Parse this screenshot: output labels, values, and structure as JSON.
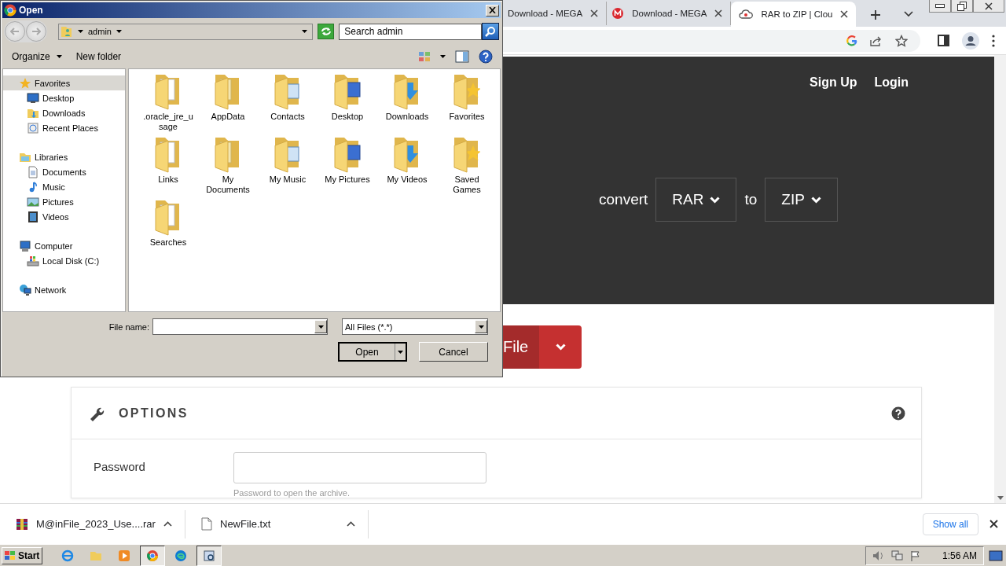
{
  "browser": {
    "tabs": [
      {
        "label": "Download - MEGA",
        "selected": false
      },
      {
        "label": "Download - MEGA",
        "selected": false
      },
      {
        "label": "RAR to ZIP | Clou",
        "selected": true
      }
    ],
    "nav_links": [
      "Sign Up",
      "Login"
    ],
    "converter": {
      "prefix": "convert",
      "from": "RAR",
      "joiner": "to",
      "to": "ZIP"
    },
    "upload_button": "File",
    "options": {
      "title": "OPTIONS",
      "fields": [
        {
          "label": "Password",
          "hint": "Password to open the archive."
        }
      ]
    }
  },
  "dialog": {
    "title": "Open",
    "address_path": "admin",
    "search_placeholder": "Search admin",
    "toolbar": [
      "Organize",
      "New folder"
    ],
    "nav": [
      {
        "label": "Favorites",
        "selected": true,
        "children": [
          {
            "label": "Desktop",
            "selected": false
          },
          {
            "label": "Downloads",
            "selected": false
          },
          {
            "label": "Recent Places",
            "selected": false
          }
        ]
      },
      {
        "label": "Libraries",
        "selected": false,
        "children": [
          {
            "label": "Documents",
            "selected": false
          },
          {
            "label": "Music",
            "selected": false
          },
          {
            "label": "Pictures",
            "selected": false
          },
          {
            "label": "Videos",
            "selected": false
          }
        ]
      },
      {
        "label": "Computer",
        "selected": false,
        "children": [
          {
            "label": "Local Disk (C:)",
            "selected": false
          }
        ]
      },
      {
        "label": "Network",
        "selected": false
      }
    ],
    "items": [
      ".oracle_jre_usage",
      "AppData",
      "Contacts",
      "Desktop",
      "Downloads",
      "Favorites",
      "Links",
      "My Documents",
      "My Music",
      "My Pictures",
      "My Videos",
      "Saved Games",
      "Searches"
    ],
    "file_name_label": "File name:",
    "file_type": "All Files (*.*)",
    "buttons": [
      "Open",
      "Cancel"
    ]
  },
  "downloads": {
    "items": [
      {
        "name": "M@inFile_2023_Use....rar",
        "kind": "archive"
      },
      {
        "name": "NewFile.txt",
        "kind": "text"
      }
    ],
    "show_all": "Show all"
  },
  "taskbar": {
    "start": "Start",
    "apps": [
      {
        "active": false
      },
      {
        "active": false
      },
      {
        "active": false
      },
      {
        "active": true
      },
      {
        "active": false
      },
      {
        "active": true
      }
    ],
    "clock": "1:56 AM"
  }
}
